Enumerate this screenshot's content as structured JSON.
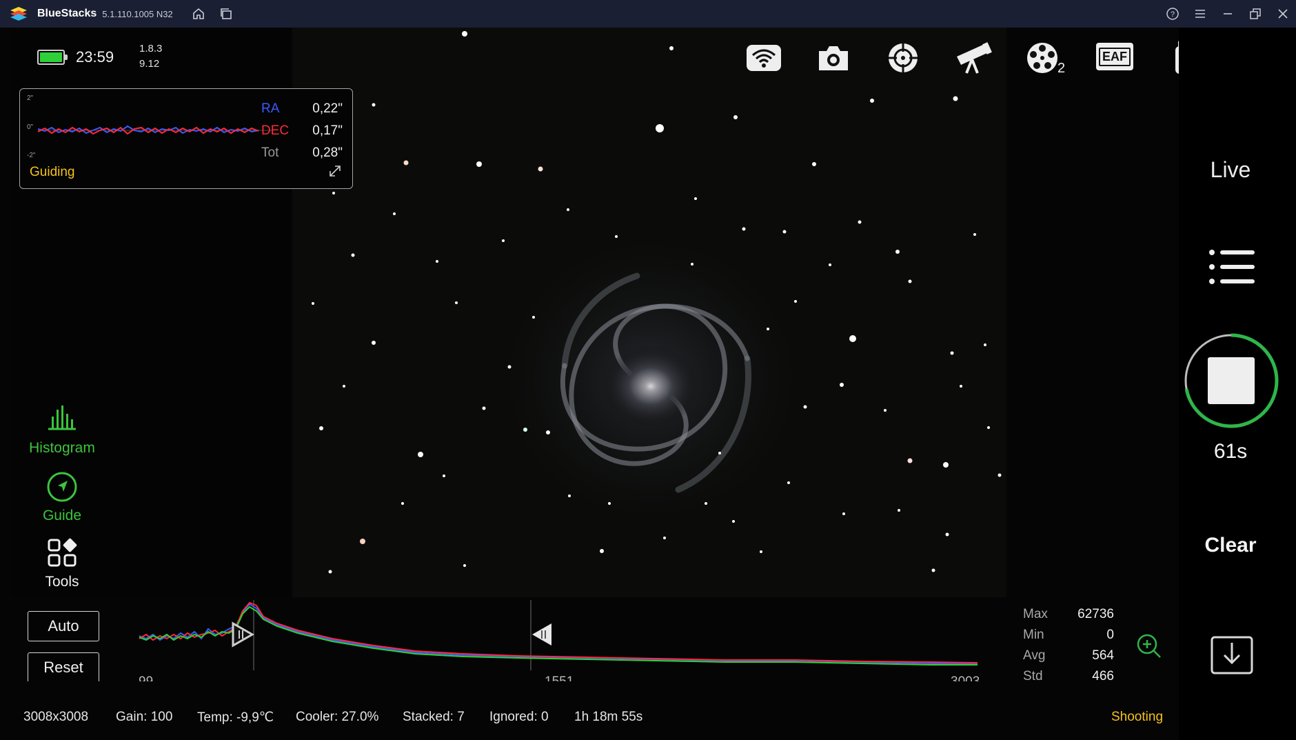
{
  "titlebar": {
    "app_name": "BlueStacks",
    "version": "5.1.110.1005  N32"
  },
  "top_left": {
    "clock": "23:59",
    "version_line1": "1.8.3",
    "version_line2": "9.12"
  },
  "guiding_panel": {
    "title": "Guiding",
    "axis_top": "2\"",
    "axis_mid": "0\"",
    "axis_bottom": "-2\"",
    "ra_label": "RA",
    "ra_value": "0,22\"",
    "dec_label": "DEC",
    "dec_value": "0,17\"",
    "tot_label": "Tot",
    "tot_value": "0,28\"",
    "colors": {
      "ra": "#3a5bff",
      "dec": "#ff2a3a",
      "title": "#f4c21c"
    }
  },
  "top_icons": [
    "wifi-icon",
    "camera-icon",
    "target-icon",
    "telescope-icon",
    "filter-wheel-icon",
    "eaf-icon",
    "usb-drive-icon",
    "info-icon"
  ],
  "filter_wheel_slot": "2",
  "eaf_label": "EAF",
  "left_tools": {
    "histogram": "Histogram",
    "guide": "Guide",
    "tools": "Tools",
    "active_color": "#3cc43c"
  },
  "right_panel": {
    "live": "Live",
    "timer": "61s",
    "clear": "Clear",
    "progress_ring_fraction": 0.72,
    "ring_color": "#2fb54a"
  },
  "histogram": {
    "auto_label": "Auto",
    "reset_label": "Reset",
    "min_label": "99",
    "mid_label": "1551",
    "max_label": "3003"
  },
  "stats": {
    "max_label": "Max",
    "max_value": "62736",
    "min_label": "Min",
    "min_value": "0",
    "avg_label": "Avg",
    "avg_value": "564",
    "std_label": "Std",
    "std_value": "466"
  },
  "status_bar": {
    "resolution": "3008x3008",
    "gain": "Gain: 100",
    "temp": "Temp: -9,9℃",
    "cooler": "Cooler: 27.0%",
    "stacked": "Stacked: 7",
    "ignored": "Ignored: 0",
    "elapsed": "1h 18m 55s",
    "state": "Shooting",
    "state_color": "#f4c21c"
  }
}
